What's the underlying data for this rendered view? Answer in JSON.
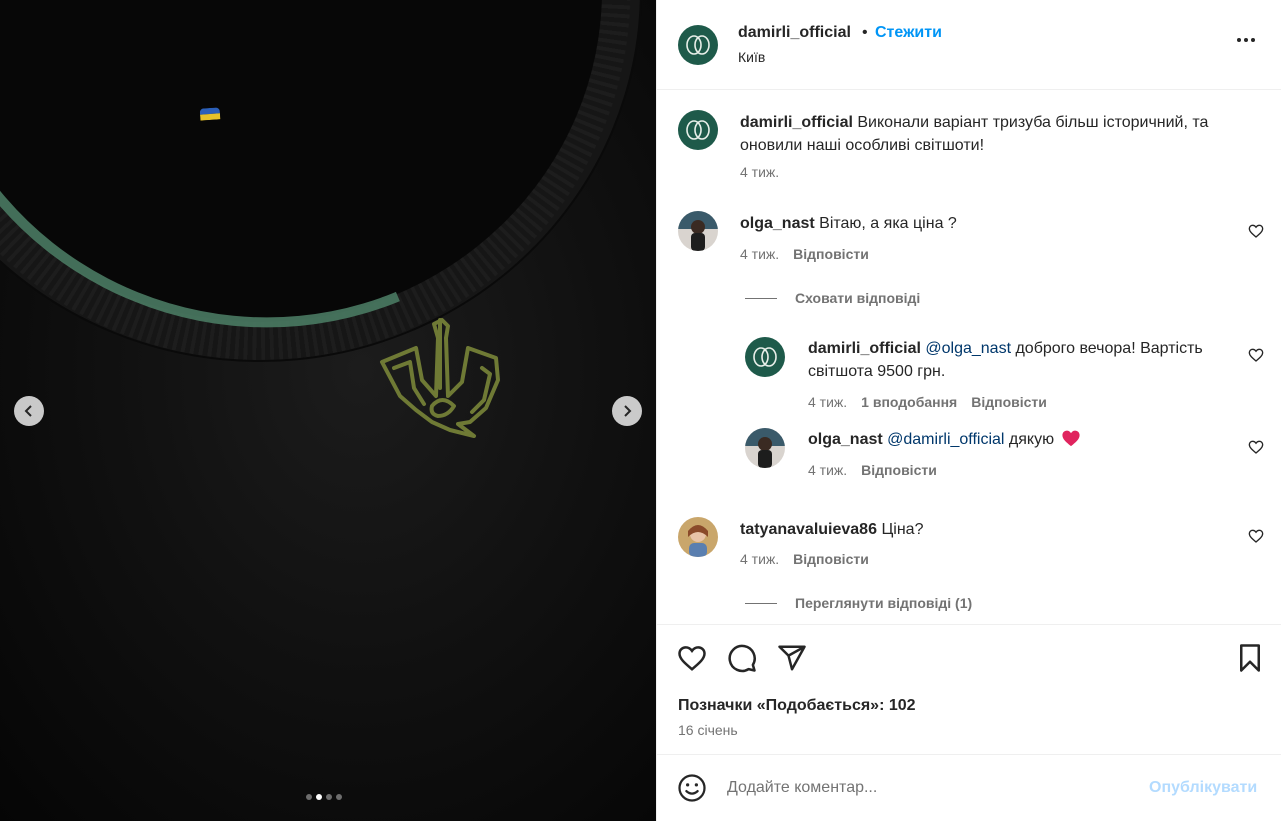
{
  "post": {
    "author": "damirli_official",
    "follow_label": "Стежити",
    "separator": "•",
    "location": "Київ",
    "caption": "Виконали варіант тризуба більш історичний, та оновили наші особливі світшоти!",
    "caption_time": "4 тиж.",
    "likes_text": "Позначки «Подобається»: 102",
    "date": "16 січень"
  },
  "comments": [
    {
      "user": "olga_nast",
      "text": "Вітаю, а яка ціна ?",
      "time": "4 тиж.",
      "reply_label": "Відповісти",
      "toggle_replies": "Сховати відповіді",
      "replies": [
        {
          "user": "damirli_official",
          "mention": "@olga_nast",
          "text": " доброго вечора! Вартість світшота 9500 грн.",
          "time": "4 тиж.",
          "likes": "1 вподобання",
          "reply_label": "Відповісти"
        },
        {
          "user": "olga_nast",
          "mention": "@damirli_official",
          "text": " дякую",
          "time": "4 тиж.",
          "reply_label": "Відповісти"
        }
      ]
    },
    {
      "user": "tatyanavaluieva86",
      "text": "Ціна?",
      "time": "4 тиж.",
      "reply_label": "Відповісти",
      "view_replies": "Переглянути відповіді (1)"
    }
  ],
  "composer": {
    "placeholder": "Додайте коментар...",
    "publish_label": "Опублікувати"
  },
  "carousel": {
    "slide_count": 4,
    "active_index": 1
  },
  "icons": [
    "chevron-left-icon",
    "chevron-right-icon",
    "more-icon",
    "heart-icon",
    "comment-icon",
    "share-icon",
    "bookmark-icon",
    "emoji-icon",
    "red-heart-emoji-icon"
  ],
  "colors": {
    "accent": "#0095f6",
    "brand_avatar": "#1e5a4a",
    "muted": "#737373",
    "publish_disabled": "#b3dbff"
  }
}
